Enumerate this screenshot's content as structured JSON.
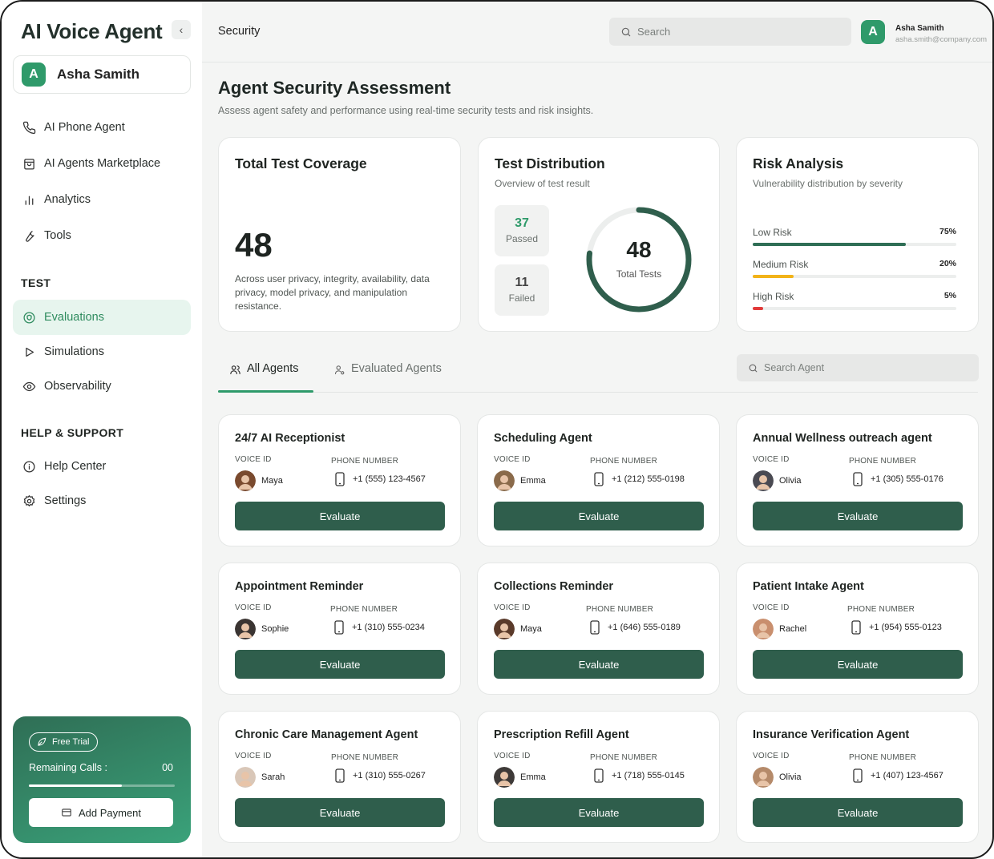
{
  "sidebar": {
    "app_title": "AI Voice Agent",
    "user": {
      "initial": "A",
      "name": "Asha Samith"
    },
    "main_nav": [
      {
        "label": "AI Phone Agent",
        "icon": "phone-icon"
      },
      {
        "label": "AI Agents Marketplace",
        "icon": "shopping-bag-icon"
      },
      {
        "label": "Analytics",
        "icon": "bar-chart-icon"
      },
      {
        "label": "Tools",
        "icon": "wrench-icon"
      }
    ],
    "test_section": "TEST",
    "test_nav": [
      {
        "label": "Evaluations",
        "icon": "shield-icon",
        "active": true
      },
      {
        "label": "Simulations",
        "icon": "play-icon"
      },
      {
        "label": "Observability",
        "icon": "eye-icon"
      }
    ],
    "help_section": "HELP & SUPPORT",
    "help_nav": [
      {
        "label": "Help Center",
        "icon": "info-icon"
      },
      {
        "label": "Settings",
        "icon": "gear-icon"
      }
    ],
    "trial": {
      "badge": "Free Trial",
      "remaining_label": "Remaining Calls :",
      "remaining_value": "00",
      "progress": 0.64,
      "add_payment": "Add Payment"
    }
  },
  "topbar": {
    "breadcrumb": "Security",
    "search_placeholder": "Search",
    "user_initial": "A",
    "user_name": "Asha Samith",
    "user_email": "asha.smith@company.com"
  },
  "page": {
    "title": "Agent Security Assessment",
    "subtitle": "Assess agent safety and performance using real-time security tests and risk insights."
  },
  "coverage": {
    "title": "Total Test Coverage",
    "value": "48",
    "description": "Across user privacy, integrity, availability, data privacy, model privacy, and manipulation resistance."
  },
  "distribution": {
    "title": "Test Distribution",
    "subtitle": "Overview of test result",
    "passed_value": "37",
    "passed_label": "Passed",
    "failed_value": "11",
    "failed_label": "Failed",
    "total_value": "48",
    "total_label": "Total Tests",
    "passed_fraction": 0.77
  },
  "risk": {
    "title": "Risk Analysis",
    "subtitle": "Vulnerability distribution by severity",
    "items": [
      {
        "label": "Low Risk",
        "percent": "75%",
        "value": 0.75,
        "color": "#2f6e55"
      },
      {
        "label": "Medium Risk",
        "percent": "20%",
        "value": 0.2,
        "color": "#f2b318"
      },
      {
        "label": "High Risk",
        "percent": "5%",
        "value": 0.05,
        "color": "#e23b3b"
      }
    ]
  },
  "tabs": {
    "all_agents": "All Agents",
    "evaluated_agents": "Evaluated Agents",
    "search_placeholder": "Search Agent"
  },
  "agent_labels": {
    "voice_id": "VOICE ID",
    "phone_number": "PHONE NUMBER",
    "evaluate": "Evaluate"
  },
  "agents": [
    {
      "name": "24/7 AI Receptionist",
      "voice": "Maya",
      "phone": "+1 (555) 123-4567",
      "avatar_color": "#7a4a2e"
    },
    {
      "name": "Scheduling Agent",
      "voice": "Emma",
      "phone": "+1 (212) 555-0198",
      "avatar_color": "#8a6a4a"
    },
    {
      "name": "Annual Wellness outreach agent",
      "voice": "Olivia",
      "phone": "+1 (305) 555-0176",
      "avatar_color": "#4a4a52"
    },
    {
      "name": "Appointment Reminder",
      "voice": "Sophie",
      "phone": "+1 (310) 555-0234",
      "avatar_color": "#3a3432"
    },
    {
      "name": "Collections Reminder",
      "voice": "Maya",
      "phone": "+1 (646) 555-0189",
      "avatar_color": "#5a3a2a"
    },
    {
      "name": "Patient Intake Agent",
      "voice": "Rachel",
      "phone": "+1 (954) 555-0123",
      "avatar_color": "#c98f6e"
    },
    {
      "name": "Chronic Care Management Agent",
      "voice": "Sarah",
      "phone": "+1 (310) 555-0267",
      "avatar_color": "#d9c7b8"
    },
    {
      "name": "Prescription Refill Agent",
      "voice": "Emma",
      "phone": "+1 (718) 555-0145",
      "avatar_color": "#3e3a38"
    },
    {
      "name": "Insurance Verification Agent",
      "voice": "Olivia",
      "phone": "+1 (407) 123-4567",
      "avatar_color": "#b58a6a"
    }
  ]
}
